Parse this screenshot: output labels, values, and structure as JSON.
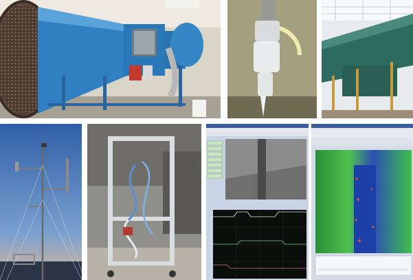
{
  "layout": "photo-collage",
  "tiles": [
    {
      "id": "t1",
      "subject": "blue-wind-tunnel-with-honeycomb-intake"
    },
    {
      "id": "t2",
      "subject": "ice-accreted-cylinder-in-test-section"
    },
    {
      "id": "t3",
      "subject": "large-green-wind-tunnel-under-skylight"
    },
    {
      "id": "t4",
      "subject": "meteorological-mast-against-sky"
    },
    {
      "id": "t5",
      "subject": "aluminium-frame-test-rig-with-tubing"
    },
    {
      "id": "t6",
      "subject": "camera-and-signal-monitor-software"
    },
    {
      "id": "t7",
      "subject": "false-color-thermal-image-software"
    }
  ],
  "colors": {
    "tunnel_blue": "#2f7fc1",
    "tunnel_green": "#2f6a5e",
    "sky_blue": "#4f79b8",
    "thermal_green": "#3fbf4a",
    "thermal_blue": "#1d3fa8",
    "scope_bg": "#0b0f0b",
    "software_panel": "#c9d4e4"
  }
}
